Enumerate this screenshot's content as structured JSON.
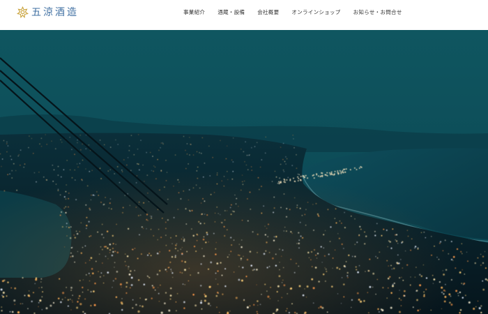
{
  "header": {
    "logo_text": "五涼酒造",
    "logo_icon": "crest-icon",
    "brand_color": "#3f6fa2"
  },
  "nav": {
    "items": [
      {
        "label": "事業紹介"
      },
      {
        "label": "酒蔵・設備"
      },
      {
        "label": "会社概要"
      },
      {
        "label": "オンラインショップ"
      },
      {
        "label": "お知らせ・お問合せ"
      }
    ]
  },
  "hero": {
    "image": "night-city-view-from-mountain"
  }
}
